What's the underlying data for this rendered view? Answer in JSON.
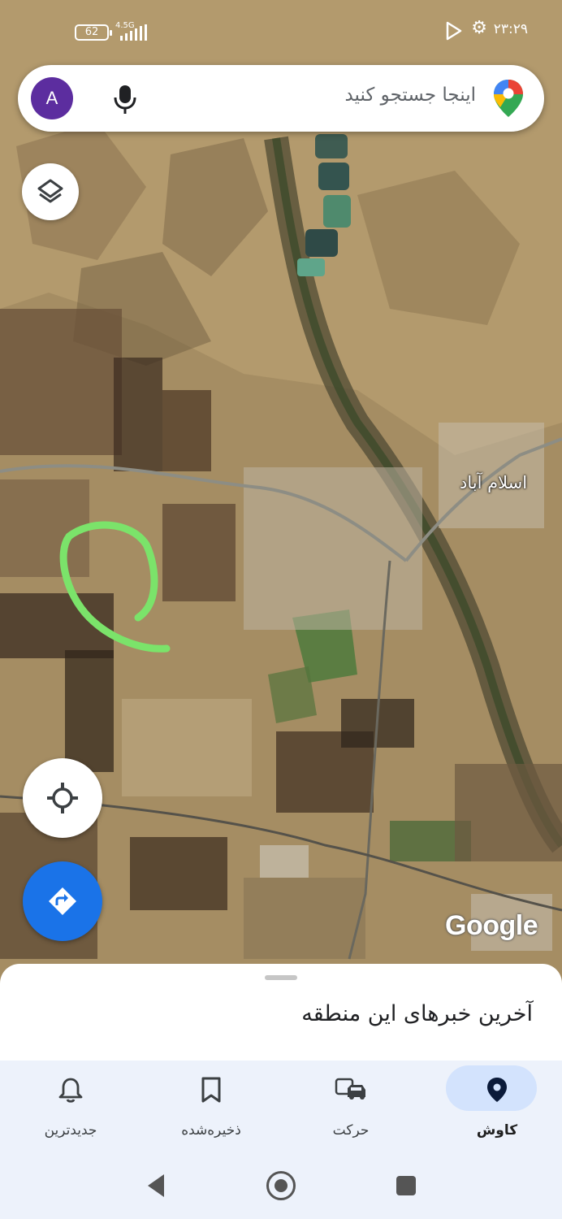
{
  "status_bar": {
    "time": "۲۳:۲۹",
    "battery": "62",
    "network": "4.5G",
    "icons": [
      "play-icon",
      "gear-icon",
      "signal-icon",
      "battery-icon"
    ]
  },
  "search": {
    "placeholder": "اینجا جستجو کنید",
    "avatar_letter": "A",
    "avatar_color": "#5c2d9f"
  },
  "map": {
    "place_label": "اسلام آباد",
    "attribution": "Google",
    "annotation_color": "#7be36a"
  },
  "bottom_sheet": {
    "title": "آخرین خبرهای این منطقه"
  },
  "bottom_nav": {
    "items": [
      {
        "label": "کاوش",
        "icon": "pin-icon",
        "active": true
      },
      {
        "label": "حرکت",
        "icon": "commute-icon",
        "active": false
      },
      {
        "label": "ذخیره‌شده",
        "icon": "bookmark-icon",
        "active": false
      },
      {
        "label": "جدیدترین",
        "icon": "bell-icon",
        "active": false
      }
    ]
  },
  "colors": {
    "accent": "#1a73e8",
    "nav_background": "#edf2fb",
    "active_pill": "#d3e3fd"
  }
}
